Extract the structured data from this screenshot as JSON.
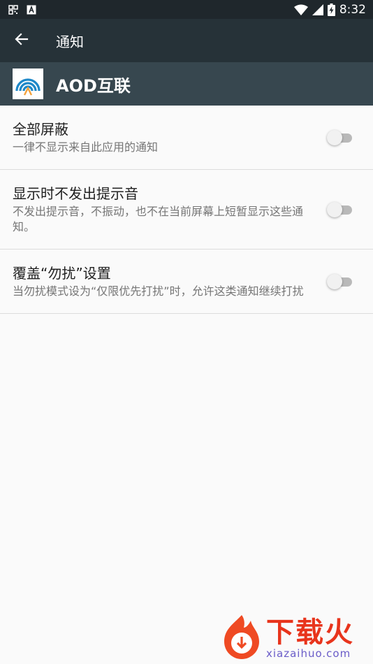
{
  "status_bar": {
    "time": "8:32",
    "left_icons": [
      "qr-notification-icon",
      "text-notification-icon"
    ],
    "right_icons": [
      "wifi-icon",
      "signal-icon",
      "battery-charging-icon"
    ]
  },
  "toolbar": {
    "title": "通知"
  },
  "app": {
    "name": "AOD互联"
  },
  "settings": [
    {
      "title": "全部屏蔽",
      "summary": "一律不显示来自此应用的通知",
      "enabled": false
    },
    {
      "title": "显示时不发出提示音",
      "summary": "不发出提示音，不振动，也不在当前屏幕上短暂显示这些通知。",
      "enabled": false
    },
    {
      "title": "覆盖“勿扰”设置",
      "summary": "当勿扰模式设为“仅限优先打扰”时，允许这类通知继续打扰",
      "enabled": false
    }
  ],
  "watermark": {
    "title": "下载火",
    "subtitle": "xiazaihuo.com"
  },
  "colors": {
    "status_bar": "#1f272c",
    "toolbar": "#263238",
    "app_header": "#37474f",
    "background": "#fafafa",
    "watermark": "#e8341c"
  }
}
